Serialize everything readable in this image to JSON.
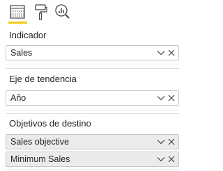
{
  "tabs": {
    "fields": {
      "icon": "fields-grid-icon",
      "selected": true
    },
    "format": {
      "icon": "paint-roller-icon"
    },
    "analytics": {
      "icon": "analytics-magnifier-icon"
    }
  },
  "sections": [
    {
      "label": "Indicador",
      "fields": [
        {
          "name": "Sales"
        }
      ]
    },
    {
      "label": "Eje de tendencia",
      "fields": [
        {
          "name": "Año"
        }
      ]
    },
    {
      "label": "Objetivos de destino",
      "fields": [
        {
          "name": "Sales objective"
        },
        {
          "name": "Minimum Sales"
        }
      ]
    }
  ],
  "colors": {
    "accent": "#f2c811",
    "text": "#252423",
    "border": "#c8c6c4"
  }
}
